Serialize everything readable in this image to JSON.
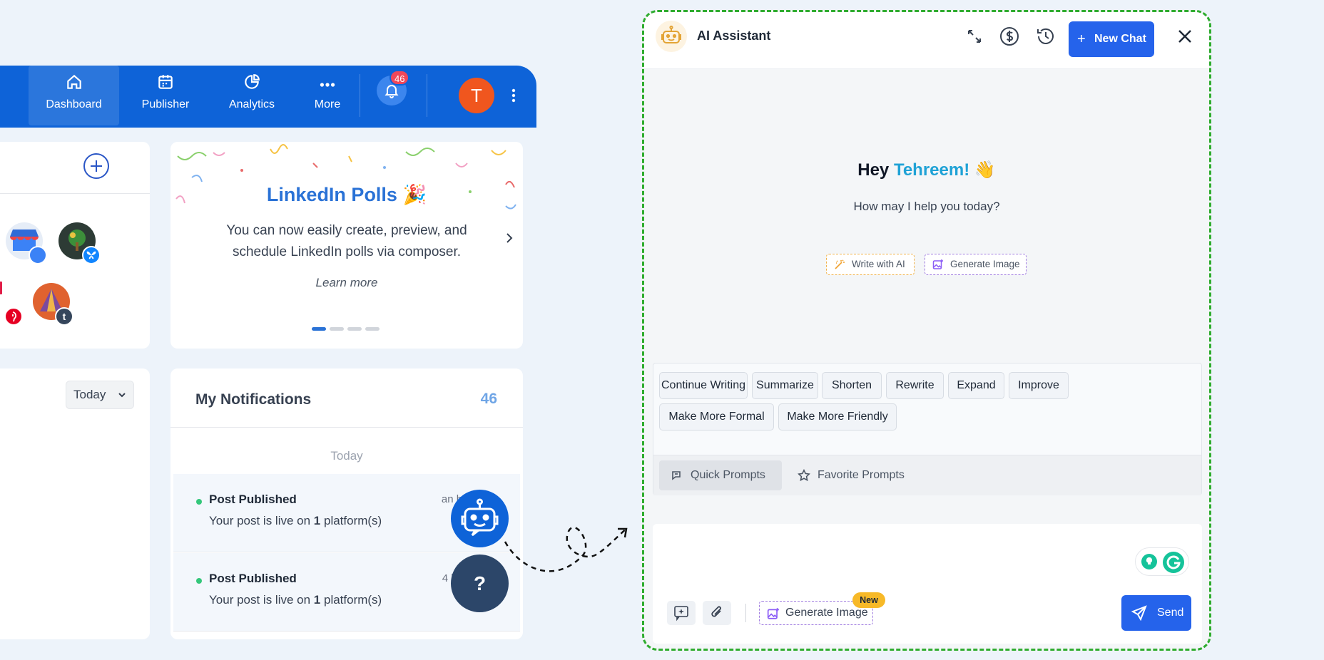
{
  "nav": {
    "items": [
      {
        "label": "Dashboard",
        "icon": "home-icon"
      },
      {
        "label": "Publisher",
        "icon": "calendar-icon"
      },
      {
        "label": "Analytics",
        "icon": "chart-pie-icon"
      },
      {
        "label": "More",
        "icon": "more-dots-icon"
      }
    ],
    "notification_badge": "46",
    "avatar_initial": "T"
  },
  "promo": {
    "title": "LinkedIn Polls 🎉",
    "text": "You can now easily create, preview, and schedule LinkedIn polls via composer.",
    "link": "Learn more"
  },
  "filter": {
    "selected": "Today"
  },
  "notifications": {
    "title": "My Notifications",
    "count": "46",
    "day": "Today",
    "items": [
      {
        "title": "Post Published",
        "body_prefix": "Your post is live on ",
        "count": "1",
        "body_suffix": " platform(s)",
        "time": "an hour ago"
      },
      {
        "title": "Post Published",
        "body_prefix": "Your post is live on ",
        "count": "1",
        "body_suffix": " platform(s)",
        "time": "4 hours ago"
      }
    ]
  },
  "fab": {
    "help": "?"
  },
  "assistant": {
    "title": "AI Assistant",
    "new_chat": "New Chat",
    "greeting_prefix": "Hey ",
    "greeting_name": "Tehreem!",
    "greeting_emoji": "👋",
    "subtitle": "How may I help you today?",
    "chips": [
      "Write with AI",
      "Generate Image"
    ],
    "prompts": [
      "Continue Writing",
      "Summarize",
      "Shorten",
      "Rewrite",
      "Expand",
      "Improve",
      "Make More Formal",
      "Make More Friendly"
    ],
    "tabs": [
      "Quick Prompts",
      "Favorite Prompts"
    ],
    "composer": {
      "generate_label": "Generate Image",
      "new_badge": "New",
      "send_label": "Send"
    }
  },
  "colors": {
    "nav_blue": "#0e63d8",
    "primary": "#2563eb",
    "panel_border": "#2fac2f",
    "name_accent": "#1fa2d6",
    "badge_red": "#f0475a"
  }
}
